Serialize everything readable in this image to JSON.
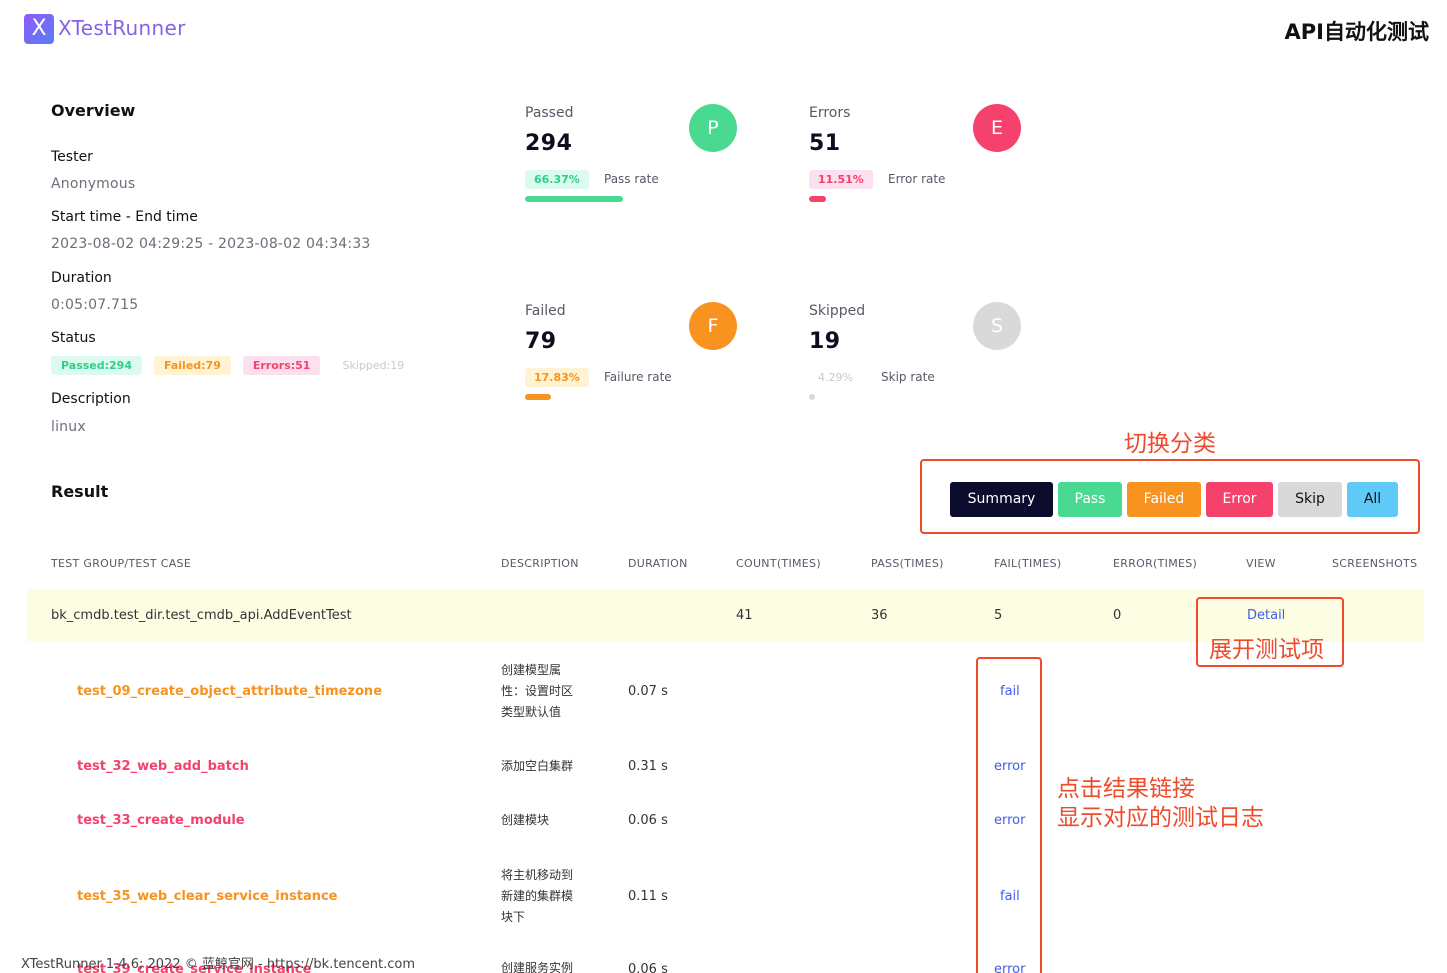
{
  "header": {
    "logo_letter": "X",
    "app_name": "XTestRunner",
    "title": "API自动化测试"
  },
  "overview": {
    "heading": "Overview",
    "tester_label": "Tester",
    "tester": "Anonymous",
    "time_label": "Start time - End time",
    "time": "2023-08-02 04:29:25 - 2023-08-02 04:34:33",
    "duration_label": "Duration",
    "duration": "0:05:07.715",
    "status_label": "Status",
    "status_chips": [
      "Passed:294",
      "Failed:79",
      "Errors:51",
      "Skipped:19"
    ],
    "description_label": "Description",
    "description": "linux"
  },
  "stats": {
    "passed": {
      "label": "Passed",
      "count": "294",
      "letter": "P",
      "rate": "66.37%",
      "rate_label": "Pass rate",
      "fraction": 0.6637,
      "color": "#4ad991"
    },
    "errors": {
      "label": "Errors",
      "count": "51",
      "letter": "E",
      "rate": "11.51%",
      "rate_label": "Error rate",
      "fraction": 0.1151,
      "color": "#f5426c"
    },
    "failed": {
      "label": "Failed",
      "count": "79",
      "letter": "F",
      "rate": "17.83%",
      "rate_label": "Failure rate",
      "fraction": 0.1783,
      "color": "#f7931e"
    },
    "skipped": {
      "label": "Skipped",
      "count": "19",
      "letter": "S",
      "rate": "4.29%",
      "rate_label": "Skip rate",
      "fraction": 0.0429,
      "color": "#d9d9d9"
    }
  },
  "result": {
    "heading": "Result",
    "filters": [
      "Summary",
      "Pass",
      "Failed",
      "Error",
      "Skip",
      "All"
    ],
    "columns": [
      "TEST GROUP/TEST CASE",
      "DESCRIPTION",
      "DURATION",
      "COUNT(TIMES)",
      "PASS(TIMES)",
      "FAIL(TIMES)",
      "ERROR(TIMES)",
      "VIEW",
      "SCREENSHOTS"
    ],
    "group": {
      "name": "bk_cmdb.test_dir.test_cmdb_api.AddEventTest",
      "count": "41",
      "pass": "36",
      "fail": "5",
      "error": "0",
      "view": "Detail"
    },
    "cases": [
      {
        "name": "test_09_create_object_attribute_timezone",
        "desc": [
          "创建模型属",
          "性：设置时区",
          "类型默认值"
        ],
        "duration": "0.07 s",
        "result": "fail"
      },
      {
        "name": "test_32_web_add_batch",
        "desc": [
          "添加空白集群"
        ],
        "duration": "0.31 s",
        "result": "error"
      },
      {
        "name": "test_33_create_module",
        "desc": [
          "创建模块"
        ],
        "duration": "0.06 s",
        "result": "error"
      },
      {
        "name": "test_35_web_clear_service_instance",
        "desc": [
          "将主机移动到",
          "新建的集群模",
          "块下"
        ],
        "duration": "0.11 s",
        "result": "fail"
      },
      {
        "name": "test_39_create_service_instance",
        "desc": [
          "创建服务实例"
        ],
        "duration": "0.06 s",
        "result": "error"
      }
    ]
  },
  "annotations": {
    "switch": "切换分类",
    "expand": "展开测试项",
    "click_line1": "点击结果链接",
    "click_line2": "显示对应的测试日志"
  },
  "footer": "XTestRunner 1.4.6; 2022 © 蓝鲸官网 - https://bk.tencent.com",
  "colors": {
    "pass": "#4ad991",
    "fail": "#f7931e",
    "error": "#f5426c",
    "skip": "#d9d9d9",
    "link": "#3f5ee6",
    "annotation": "#ee4b2b"
  }
}
